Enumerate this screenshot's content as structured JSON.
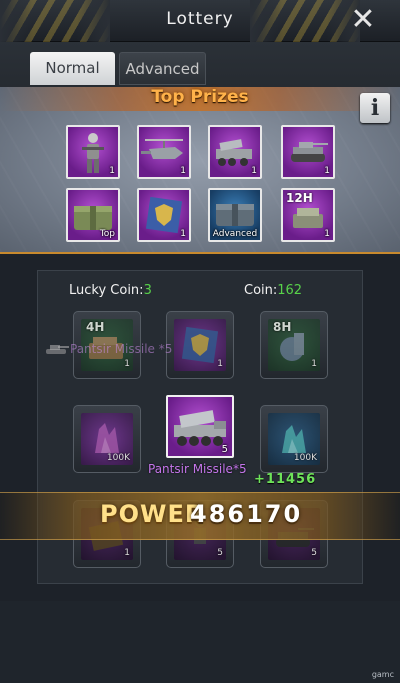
{
  "header": {
    "title": "Lottery"
  },
  "tabs": [
    {
      "label": "Normal",
      "active": true
    },
    {
      "label": "Advanced",
      "active": false
    }
  ],
  "top_prizes": {
    "title": "Top Prizes",
    "info_label": "i",
    "items": [
      {
        "icon": "soldier-icon",
        "qty": "1",
        "rarity": "purple"
      },
      {
        "icon": "helicopter-icon",
        "qty": "1",
        "rarity": "purple"
      },
      {
        "icon": "missile-truck-icon",
        "qty": "1",
        "rarity": "purple"
      },
      {
        "icon": "tank-icon",
        "qty": "1",
        "rarity": "purple"
      },
      {
        "icon": "supply-crate-icon",
        "tag": "Top",
        "rarity": "purple"
      },
      {
        "icon": "shield-badge-icon",
        "qty": "1",
        "rarity": "purple"
      },
      {
        "icon": "supply-crate-icon",
        "tag": "Advanced",
        "rarity": "blue"
      },
      {
        "icon": "speedup-icon",
        "hours": "12H",
        "qty": "1",
        "rarity": "purple"
      }
    ]
  },
  "board": {
    "lucky_coin_label": "Lucky Coin:",
    "lucky_coin_value": "3",
    "coin_label": "Coin:",
    "coin_value": "162",
    "slots": [
      {
        "icon": "speedup-icon",
        "hours": "4H",
        "qty": "1",
        "rarity": "green"
      },
      {
        "icon": "shield-badge-icon",
        "qty": "1",
        "rarity": "purple"
      },
      {
        "icon": "speedup-icon",
        "hours": "8H",
        "qty": "1",
        "rarity": "green"
      },
      {
        "icon": "crystal-icon",
        "qty": "100K",
        "rarity": "purple"
      },
      {
        "icon": "crystal-icon",
        "qty": "100K",
        "rarity": "blue"
      },
      {
        "icon": "resource-icon",
        "qty": "1",
        "rarity": "purple"
      },
      {
        "icon": "soldier-icon",
        "qty": "5",
        "rarity": "purple"
      },
      {
        "icon": "tank-icon",
        "qty": "5",
        "rarity": "purple"
      }
    ],
    "selected": {
      "icon": "missile-truck-icon",
      "qty": "5"
    },
    "reward_caption": "Pantsir Missile*5",
    "ghost_caption": "Pantsir Missile *5",
    "power_delta": "+11456"
  },
  "power": {
    "label": "POWER",
    "value": "486170"
  },
  "watermark": "gamc",
  "colors": {
    "accent_orange": "#ffb24a",
    "green": "#58d24a",
    "purple": "#8a3ab0"
  }
}
